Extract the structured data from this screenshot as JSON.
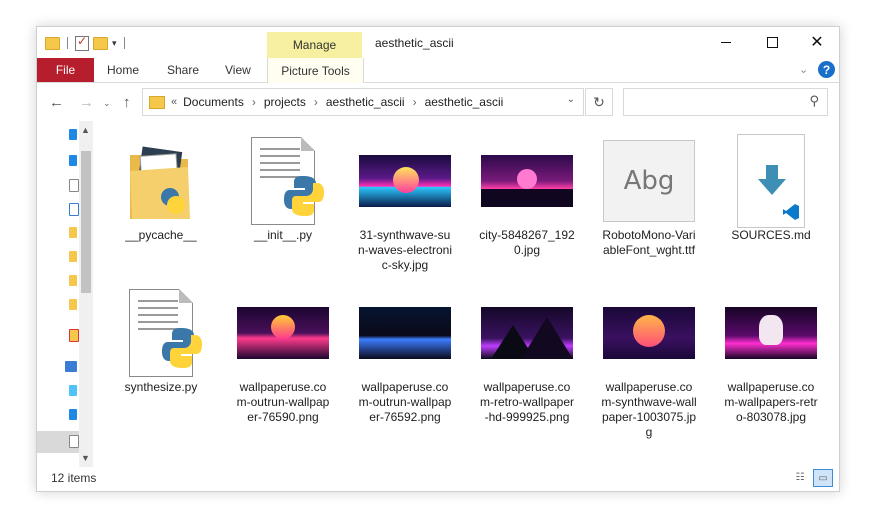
{
  "window": {
    "title": "aesthetic_ascii"
  },
  "ribbon": {
    "manage_label": "Manage",
    "tabs": [
      "File",
      "Home",
      "Share",
      "View",
      "Picture Tools"
    ]
  },
  "address": {
    "chevron": "«",
    "crumbs": [
      "Documents",
      "projects",
      "aesthetic_ascii",
      "aesthetic_ascii"
    ]
  },
  "search": {
    "placeholder": ""
  },
  "items": [
    {
      "label": "__pycache__",
      "kind": "folder"
    },
    {
      "label": "__init__.py",
      "kind": "python"
    },
    {
      "label": "31-synthwave-sun-waves-electronic-sky.jpg",
      "kind": "image",
      "palette": [
        "#1a0b3d",
        "#ff2fb4",
        "#2cc8ff"
      ]
    },
    {
      "label": "city-5848267_1920.jpg",
      "kind": "image",
      "palette": [
        "#2b0a4a",
        "#ff3fa8",
        "#10061f"
      ]
    },
    {
      "label": "RobotoMono-VariableFont_wght.ttf",
      "kind": "font",
      "glyph": "Abg"
    },
    {
      "label": "SOURCES.md",
      "kind": "markdown"
    },
    {
      "label": "synthesize.py",
      "kind": "python"
    },
    {
      "label": "wallpaperuse.com-outrun-wallpaper-76590.png",
      "kind": "image",
      "palette": [
        "#1b0630",
        "#ff3b8d",
        "#ffcc33"
      ]
    },
    {
      "label": "wallpaperuse.com-outrun-wallpaper-76592.png",
      "kind": "image",
      "palette": [
        "#061530",
        "#3c7dff",
        "#0a0a1a"
      ]
    },
    {
      "label": "wallpaperuse.com-retro-wallpaper-hd-999925.png",
      "kind": "image",
      "palette": [
        "#140828",
        "#c03cff",
        "#0a0a14"
      ]
    },
    {
      "label": "wallpaperuse.com-synthwave-wallpaper-1003075.jpg",
      "kind": "image",
      "palette": [
        "#1a0838",
        "#ff4f7a",
        "#ffb547"
      ]
    },
    {
      "label": "wallpaperuse.com-wallpapers-retro-803078.jpg",
      "kind": "image",
      "palette": [
        "#160425",
        "#ff2fd0",
        "#ffffff"
      ]
    }
  ],
  "status": {
    "count": "12 items"
  }
}
